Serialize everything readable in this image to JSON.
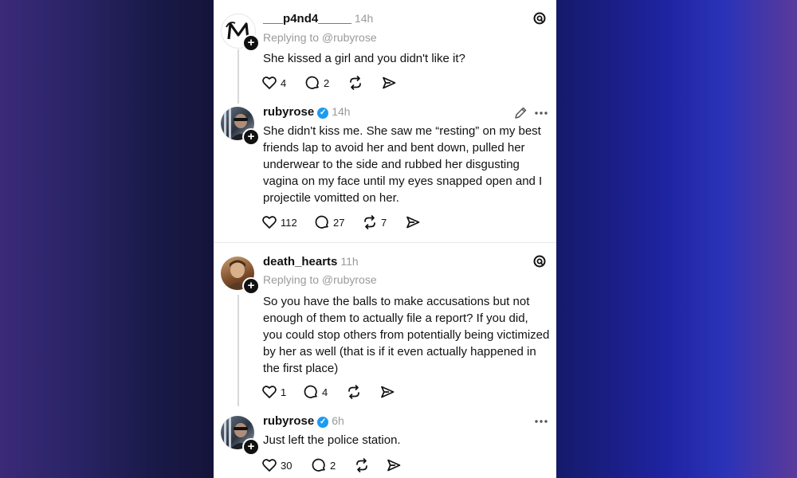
{
  "posts": [
    {
      "username": "___p4nd4_____",
      "time": "14h",
      "replying_to": "Replying to @rubyrose",
      "text": "She kissed a girl and you didn't like it?",
      "likes": "4",
      "replies": "2",
      "reposts": ""
    },
    {
      "username": "rubyrose",
      "time": "14h",
      "text": "She didn't kiss me. She saw me “resting” on my best friends lap to avoid her and bent down, pulled her underwear to the side and rubbed her disgusting vagina on my face until my eyes snapped open and I projectile vomitted on her.",
      "likes": "112",
      "replies": "27",
      "reposts": "7"
    },
    {
      "username": "death_hearts",
      "time": "11h",
      "replying_to": "Replying to @rubyrose",
      "text": "So you have the balls to make accusations but not enough of them to actually file a report? If you did, you could stop others from potentially being victimized by her as well (that is if it even actually happened in the first place)",
      "likes": "1",
      "replies": "4",
      "reposts": ""
    },
    {
      "username": "rubyrose",
      "time": "6h",
      "text": "Just left the police station.",
      "likes": "30",
      "replies": "2",
      "reposts": ""
    }
  ],
  "icons": {
    "like": "heart-icon",
    "reply": "comment-icon",
    "repost": "repost-icon",
    "share": "send-icon",
    "threads": "threads-logo-icon",
    "edit": "pencil-icon",
    "more": "more-icon",
    "follow": "plus-icon"
  },
  "colors": {
    "verified": "#1d9bf0",
    "muted": "#9a9a9a"
  }
}
